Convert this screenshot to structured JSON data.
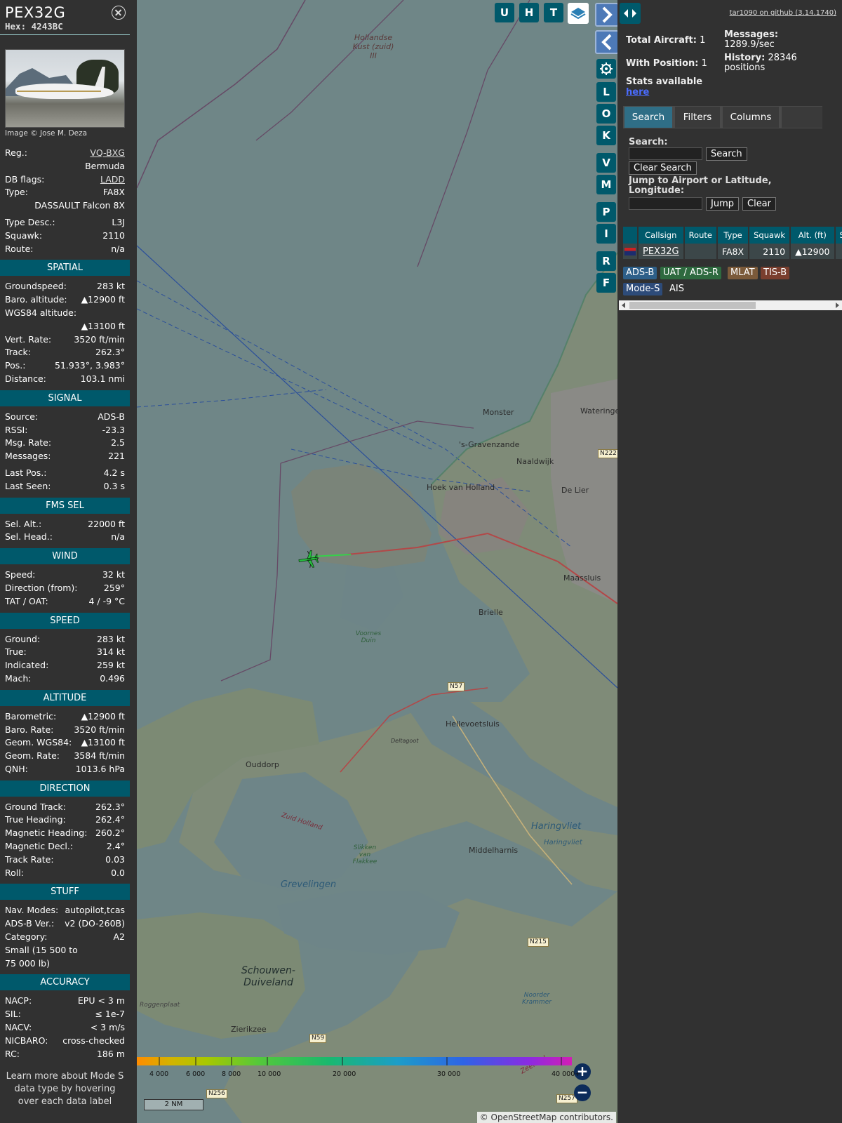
{
  "info": {
    "callsign": "PEX32G",
    "hex_label": "Hex:",
    "hex": "4243BC",
    "photo_credit": "Image © Jose M. Deza",
    "basic": [
      {
        "label": "Reg.:",
        "value": "VQ-BXG",
        "link": true
      },
      {
        "label": "",
        "value": "Bermuda"
      },
      {
        "label": "DB flags:",
        "value": "LADD",
        "link": true
      },
      {
        "label": "Type:",
        "value": "FA8X"
      },
      {
        "label": "",
        "value": "DASSAULT Falcon 8X"
      },
      {
        "gap": true
      },
      {
        "label": "Type Desc.:",
        "value": "L3J"
      },
      {
        "label": "Squawk:",
        "value": "2110"
      },
      {
        "label": "Route:",
        "value": "n/a"
      }
    ],
    "sections": [
      {
        "title": "SPATIAL",
        "rows": [
          {
            "label": "Groundspeed:",
            "value": "283 kt"
          },
          {
            "label": "Baro. altitude:",
            "value": "▲12900 ft"
          },
          {
            "label": "WGS84 altitude:",
            "value": ""
          },
          {
            "label": "",
            "value": "▲13100 ft"
          },
          {
            "label": "Vert. Rate:",
            "value": "3520 ft/min"
          },
          {
            "label": "Track:",
            "value": "262.3°"
          },
          {
            "label": "Pos.:",
            "value": "51.933°, 3.983°"
          },
          {
            "label": "Distance:",
            "value": "103.1 nmi"
          }
        ]
      },
      {
        "title": "SIGNAL",
        "rows": [
          {
            "label": "Source:",
            "value": "ADS-B"
          },
          {
            "label": "RSSI:",
            "value": "-23.3"
          },
          {
            "label": "Msg. Rate:",
            "value": "2.5"
          },
          {
            "label": "Messages:",
            "value": "221"
          },
          {
            "gap": true
          },
          {
            "label": "Last Pos.:",
            "value": "4.2 s"
          },
          {
            "label": "Last Seen:",
            "value": "0.3 s"
          }
        ]
      },
      {
        "title": "FMS SEL",
        "rows": [
          {
            "label": "Sel. Alt.:",
            "value": "22000 ft"
          },
          {
            "label": "Sel. Head.:",
            "value": "n/a"
          }
        ]
      },
      {
        "title": "WIND",
        "rows": [
          {
            "label": "Speed:",
            "value": "32 kt"
          },
          {
            "label": "Direction (from):",
            "value": "259°"
          },
          {
            "label": "TAT / OAT:",
            "value": "4 / -9 °C"
          }
        ]
      },
      {
        "title": "SPEED",
        "rows": [
          {
            "label": "Ground:",
            "value": "283 kt"
          },
          {
            "label": "True:",
            "value": "314 kt"
          },
          {
            "label": "Indicated:",
            "value": "259 kt"
          },
          {
            "label": "Mach:",
            "value": "0.496"
          }
        ]
      },
      {
        "title": "ALTITUDE",
        "rows": [
          {
            "label": "Barometric:",
            "value": "▲12900 ft"
          },
          {
            "label": "Baro. Rate:",
            "value": "3520 ft/min"
          },
          {
            "label": "Geom. WGS84:",
            "value": "▲13100 ft"
          },
          {
            "label": "Geom. Rate:",
            "value": "3584 ft/min"
          },
          {
            "label": "QNH:",
            "value": "1013.6 hPa"
          }
        ]
      },
      {
        "title": "DIRECTION",
        "rows": [
          {
            "label": "Ground Track:",
            "value": "262.3°"
          },
          {
            "label": "True Heading:",
            "value": "262.4°"
          },
          {
            "label": "Magnetic Heading:",
            "value": "260.2°"
          },
          {
            "label": "Magnetic Decl.:",
            "value": "2.4°"
          },
          {
            "label": "Track Rate:",
            "value": "0.03"
          },
          {
            "label": "Roll:",
            "value": "0.0"
          }
        ]
      },
      {
        "title": "STUFF",
        "rows": [
          {
            "label": "Nav. Modes:",
            "value": "autopilot,tcas"
          },
          {
            "label": "ADS-B Ver.:",
            "value": "v2 (DO-260B)"
          },
          {
            "label": "Category:",
            "value": "A2"
          },
          {
            "label": "Small (15 500 to",
            "value": ""
          },
          {
            "label": "75 000 lb)",
            "value": ""
          }
        ]
      },
      {
        "title": "ACCURACY",
        "rows": [
          {
            "label": "NACP:",
            "value": "EPU < 3 m"
          },
          {
            "label": "SIL:",
            "value": "≤ 1e-7"
          },
          {
            "label": "NACV:",
            "value": "< 3 m/s"
          },
          {
            "label": "NICBARO:",
            "value": "cross-checked"
          },
          {
            "label": "RC:",
            "value": "186 m"
          }
        ]
      }
    ],
    "note": "Learn more about Mode S data type by hovering over each data label"
  },
  "map": {
    "top_buttons": [
      "U",
      "H",
      "T"
    ],
    "side_buttons": [
      "L",
      "O",
      "K",
      "V",
      "M",
      "P",
      "I",
      "R",
      "F"
    ],
    "places": [
      {
        "name": "Monster"
      },
      {
        "name": "Wateringen"
      },
      {
        "name": "'s-Gravenzande"
      },
      {
        "name": "Naaldwijk"
      },
      {
        "name": "Hoek van Holland"
      },
      {
        "name": "De Lier"
      },
      {
        "name": "Maassluis"
      },
      {
        "name": "Brielle"
      },
      {
        "name": "Hellevoetsluis"
      },
      {
        "name": "Ouddorp"
      },
      {
        "name": "Middelharnis"
      },
      {
        "name": "Zierikzee"
      }
    ],
    "sea_label": "Hollandse Kust (zuid) III",
    "water_labels": [
      "Haringvliet",
      "Grevelingen"
    ],
    "big_labels": [
      "Schouwen-Duiveland"
    ],
    "small_labels": [
      "Voornes Duin",
      "Slikken van Flakkee",
      "Zuid Holland",
      "Roggenplaat",
      "Noorder Krammer",
      "Zeeland",
      "Deltagoot",
      "Haringvliet"
    ],
    "roads": [
      "N222",
      "N57",
      "N215",
      "N59",
      "N257",
      "N256"
    ],
    "alt_labels": [
      "4 000",
      "6 000",
      "8 000",
      "10 000",
      "20 000",
      "30 000",
      "40 000+"
    ],
    "scale": "2 NM",
    "attribution": "© OpenStreetMap contributors."
  },
  "sidebar": {
    "github": "tar1090 on github (3.14.1740)",
    "total_aircraft_label": "Total Aircraft:",
    "total_aircraft": "1",
    "with_position_label": "With Position:",
    "with_position": "1",
    "stats_label": "Stats available",
    "stats_link": "here",
    "messages_label": "Messages:",
    "messages_rate": "1289.9/sec",
    "history_label": "History:",
    "history_value": "28346",
    "history_unit": "positions",
    "tabs": [
      "Search",
      "Filters",
      "Columns"
    ],
    "search_label": "Search:",
    "search_button": "Search",
    "clear_search_button": "Clear Search",
    "jump_label": "Jump to Airport or Latitude, Longitude:",
    "jump_button": "Jump",
    "clear_button": "Clear",
    "table_headers": [
      "Callsign",
      "Route",
      "Type",
      "Squawk",
      "Alt. (ft)",
      "Spd"
    ],
    "table_row": {
      "callsign": "PEX32G",
      "route": "",
      "type": "FA8X",
      "squawk": "2110",
      "alt": "▲12900",
      "spd": ""
    },
    "sources": [
      {
        "label": "ADS-B",
        "color": "#2d5f89"
      },
      {
        "label": "UAT / ADS-R",
        "color": "#2e6a3f"
      },
      {
        "label": "MLAT",
        "color": "#7b5a3a"
      },
      {
        "label": "TIS-B",
        "color": "#7a3e2e"
      },
      {
        "label": "Mode-S",
        "color": "#2d4b79"
      },
      {
        "label": "AIS",
        "color": ""
      }
    ]
  }
}
